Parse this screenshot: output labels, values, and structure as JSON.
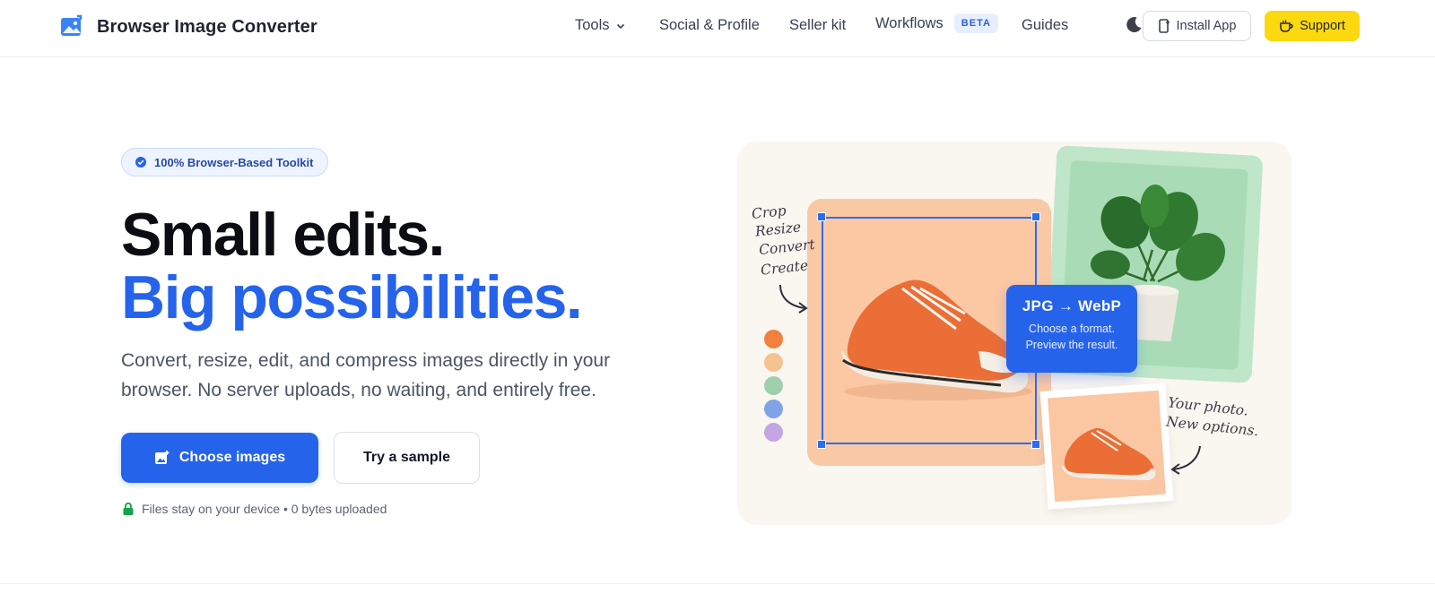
{
  "header": {
    "brand": "Browser Image Converter",
    "nav": [
      {
        "label": "Tools"
      },
      {
        "label": "Social & Profile"
      },
      {
        "label": "Seller kit"
      },
      {
        "label": "Workflows",
        "badge": "BETA"
      },
      {
        "label": "Guides"
      }
    ],
    "install_label": "Install App",
    "support_label": "Support"
  },
  "hero": {
    "badge": "100% Browser-Based Toolkit",
    "headline_1": "Small edits.",
    "headline_2": "Big possibilities.",
    "lead": "Convert, resize, edit, and compress images directly in your browser. No server uploads, no waiting, and entirely free.",
    "primary_cta": "Choose images",
    "secondary_cta": "Try a sample",
    "note": "Files stay on your device • 0 bytes uploaded"
  },
  "illustration": {
    "steps": [
      "Crop",
      "Resize",
      "Convert",
      "Create"
    ],
    "format_title": "JPG → WebP",
    "format_sub_1": "Choose a format.",
    "format_sub_2": "Preview the result.",
    "caption_1": "Your photo.",
    "caption_2": "New options.",
    "swatches": [
      "#f2813f",
      "#f5c38f",
      "#9fd0ae",
      "#7fa3e6",
      "#c3a6e3"
    ]
  },
  "colors": {
    "primary": "#2563eb",
    "support": "#fcd80f",
    "badge_bg": "#eef4ff"
  }
}
